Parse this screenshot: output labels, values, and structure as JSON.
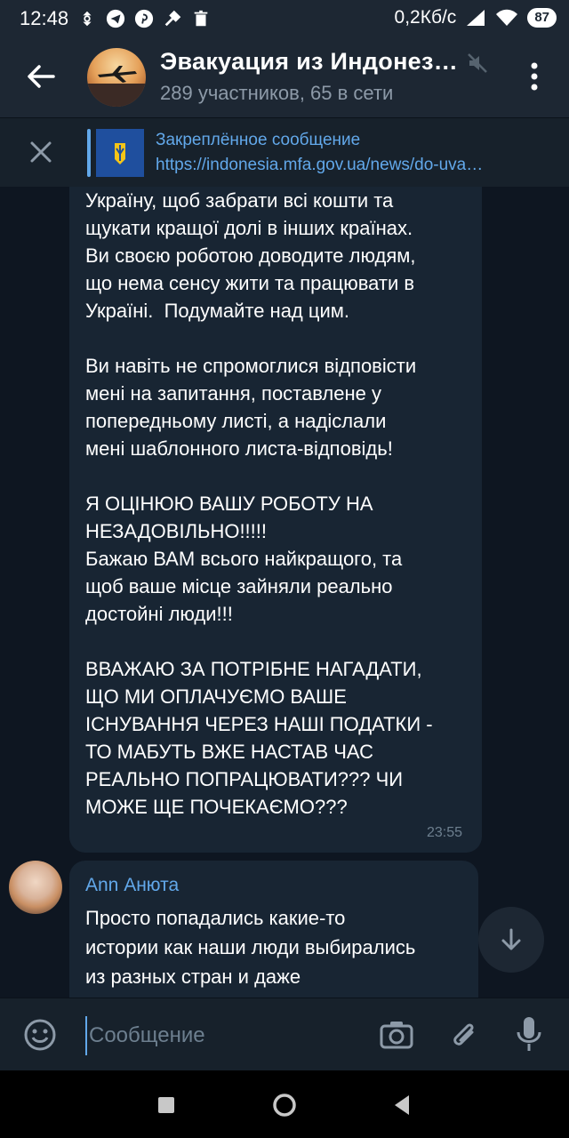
{
  "status_bar": {
    "time": "12:48",
    "network_speed": "0,2Кб/с",
    "battery": "87",
    "icons": [
      "sync-icon",
      "telegram-icon",
      "pinterest-icon",
      "tools-icon",
      "trash-icon",
      "signal-icon",
      "wifi-icon",
      "battery-icon"
    ]
  },
  "header": {
    "title": "Эвакуация из Индонез…",
    "subtitle": "289 участников, 65 в сети",
    "icons": [
      "back-arrow-icon",
      "mute-icon",
      "more-vert-icon"
    ]
  },
  "pinned": {
    "title": "Закреплённое сообщение",
    "text": "https://indonesia.mfa.gov.ua/news/do-uva…",
    "icons": [
      "close-icon"
    ]
  },
  "messages": [
    {
      "text": "Україну, щоб забрати всі кошти та\nщукати кращої долі в інших країнах.\nВи своєю роботою доводите людям,\nщо нема сенсу жити та працювати в\nУкраїні.  Подумайте над цим.\n\nВи навіть не спромоглися відповісти\nмені на запитання, поставлене у\nпопередньому листі, а надіслали\nмені шаблонного листа-відповідь!\n\nЯ ОЦІНЮЮ ВАШУ РОБОТУ НА\nНЕЗАДОВІЛЬНО!!!!!\nБажаю ВАМ всього найкращого, та\nщоб ваше місце зайняли реально\nдостойні люди!!!\n\nВВАЖАЮ ЗА ПОТРІБНЕ НАГАДАТИ,\nЩО МИ ОПЛАЧУЄМО ВАШЕ\nІСНУВАННЯ ЧЕРЕЗ НАШІ ПОДАТКИ -\nТО МАБУТЬ ВЖЕ НАСТАВ ЧАС\nРЕАЛЬНО ПОПРАЦЮВАТИ??? ЧИ\nМОЖЕ ЩЕ ПОЧЕКАЄМО???",
      "time": "23:55"
    },
    {
      "sender": "Ann Анюта",
      "text": "Просто попадались какие-то\nистории как наши люди выбирались\nиз разных стран и даже"
    }
  ],
  "input": {
    "placeholder": "Сообщение",
    "icons": [
      "emoji-icon",
      "camera-icon",
      "attach-icon",
      "mic-icon"
    ]
  },
  "colors": {
    "background": "#0e1621",
    "header": "#1d2733",
    "bubble": "#182533",
    "accent": "#62a8ea",
    "muted": "#8d9aa8"
  }
}
